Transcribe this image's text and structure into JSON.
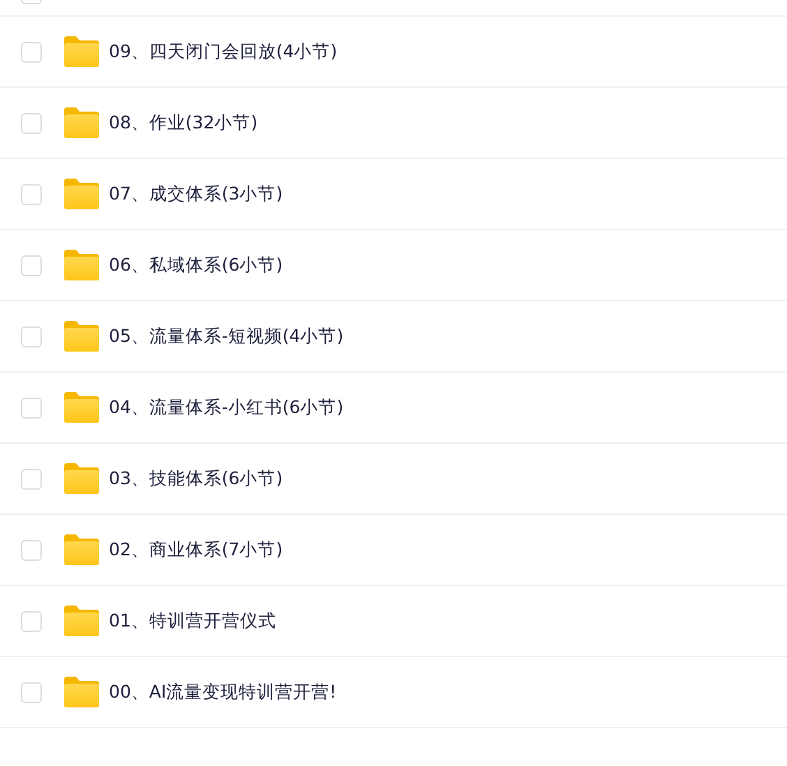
{
  "partial_row": {
    "checked": false
  },
  "folders": [
    {
      "name": "09、四天闭门会回放(4小节)",
      "checked": false
    },
    {
      "name": "08、作业(32小节)",
      "checked": false
    },
    {
      "name": "07、成交体系(3小节)",
      "checked": false
    },
    {
      "name": "06、私域体系(6小节)",
      "checked": false
    },
    {
      "name": "05、流量体系-短视频(4小节)",
      "checked": false
    },
    {
      "name": "04、流量体系-小红书(6小节)",
      "checked": false
    },
    {
      "name": "03、技能体系(6小节)",
      "checked": false
    },
    {
      "name": "02、商业体系(7小节)",
      "checked": false
    },
    {
      "name": "01、特训营开营仪式",
      "checked": false
    },
    {
      "name": "00、AI流量变现特训营开营!",
      "checked": false
    }
  ]
}
